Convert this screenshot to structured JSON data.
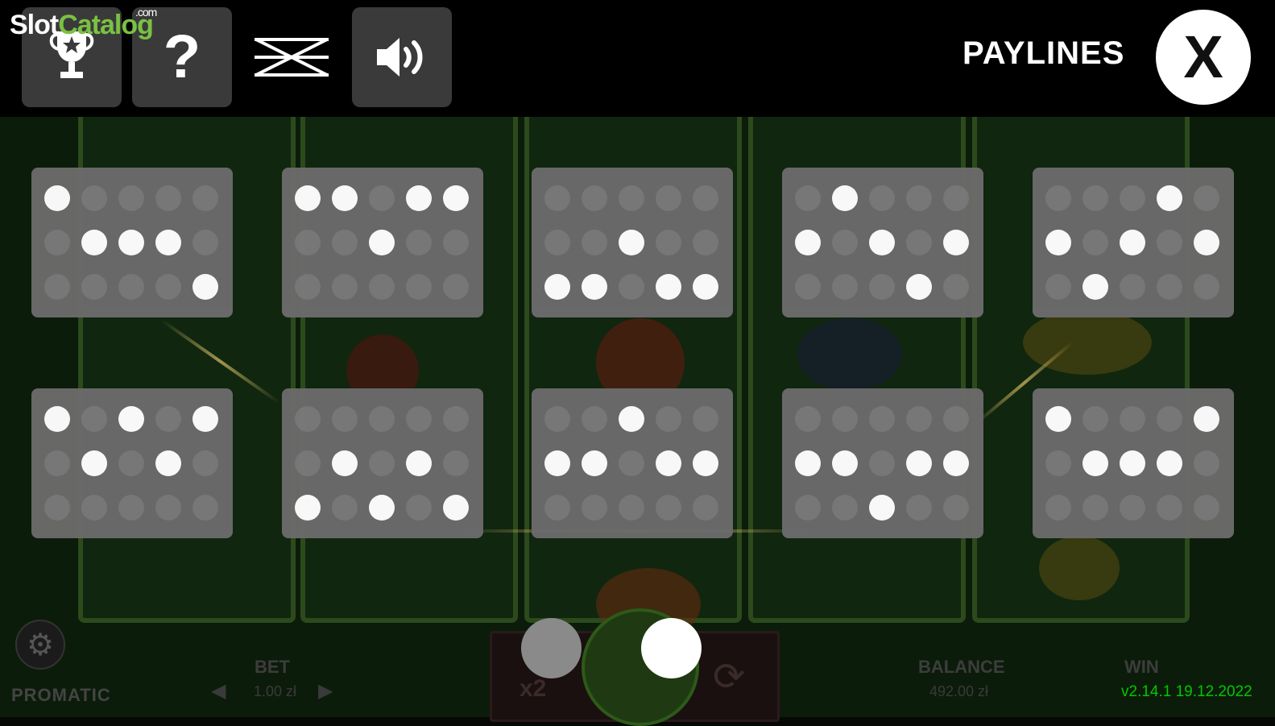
{
  "watermark": {
    "slot": "Slot",
    "catalog": "Catalog",
    "com": ".com"
  },
  "top_bar": {
    "title": "PAYLINES",
    "close_label": "X",
    "help_label": "?",
    "icons": [
      "trophy-icon",
      "help-icon",
      "autoplay-off-icon",
      "sound-icon"
    ]
  },
  "paylines": [
    [
      [
        1,
        0,
        0,
        0,
        0
      ],
      [
        0,
        1,
        1,
        1,
        0
      ],
      [
        0,
        0,
        0,
        0,
        1
      ]
    ],
    [
      [
        1,
        1,
        0,
        1,
        1
      ],
      [
        0,
        0,
        1,
        0,
        0
      ],
      [
        0,
        0,
        0,
        0,
        0
      ]
    ],
    [
      [
        0,
        0,
        0,
        0,
        0
      ],
      [
        0,
        0,
        1,
        0,
        0
      ],
      [
        1,
        1,
        0,
        1,
        1
      ]
    ],
    [
      [
        0,
        1,
        0,
        0,
        0
      ],
      [
        1,
        0,
        1,
        0,
        1
      ],
      [
        0,
        0,
        0,
        1,
        0
      ]
    ],
    [
      [
        0,
        0,
        0,
        1,
        0
      ],
      [
        1,
        0,
        1,
        0,
        1
      ],
      [
        0,
        1,
        0,
        0,
        0
      ]
    ],
    [
      [
        1,
        0,
        1,
        0,
        1
      ],
      [
        0,
        1,
        0,
        1,
        0
      ],
      [
        0,
        0,
        0,
        0,
        0
      ]
    ],
    [
      [
        0,
        0,
        0,
        0,
        0
      ],
      [
        0,
        1,
        0,
        1,
        0
      ],
      [
        1,
        0,
        1,
        0,
        1
      ]
    ],
    [
      [
        0,
        0,
        1,
        0,
        0
      ],
      [
        1,
        1,
        0,
        1,
        1
      ],
      [
        0,
        0,
        0,
        0,
        0
      ]
    ],
    [
      [
        0,
        0,
        0,
        0,
        0
      ],
      [
        1,
        1,
        0,
        1,
        1
      ],
      [
        0,
        0,
        1,
        0,
        0
      ]
    ],
    [
      [
        1,
        0,
        0,
        0,
        1
      ],
      [
        0,
        1,
        1,
        1,
        0
      ],
      [
        0,
        0,
        0,
        0,
        0
      ]
    ]
  ],
  "bottom": {
    "brand": "PROMATIC",
    "bet_label": "BET",
    "bet_value": "1.00 zł",
    "gamble_label": "x2",
    "balance_label": "BALANCE",
    "balance_value": "492.00 zł",
    "win_label": "WIN",
    "version": "v2.14.1 19.12.2022"
  }
}
